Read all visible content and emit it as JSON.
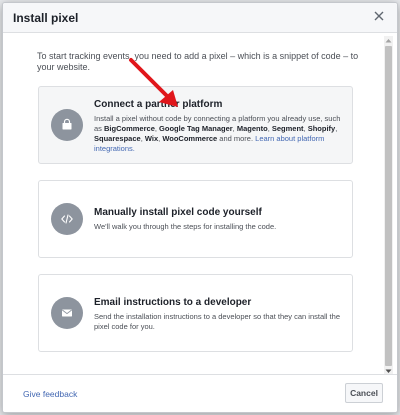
{
  "dialog": {
    "title": "Install pixel",
    "close_icon": "close-icon"
  },
  "intro": "To start tracking events, you need to add a pixel – which is a snippet of code – to your website.",
  "options": [
    {
      "icon": "shopping-bag-icon",
      "title": "Connect a partner platform",
      "desc_prefix": "Install a pixel without code by connecting a platform you already use, such as ",
      "partners": [
        "BigCommerce",
        "Google Tag Manager",
        "Magento",
        "Segment",
        "Shopify",
        "Squarespace",
        "Wix",
        "WooCommerce"
      ],
      "desc_suffix": " and more.",
      "link": "Learn about platform integrations."
    },
    {
      "icon": "code-icon",
      "title": "Manually install pixel code yourself",
      "desc": "We'll walk you through the steps for installing the code."
    },
    {
      "icon": "envelope-icon",
      "title": "Email instructions to a developer",
      "desc": "Send the installation instructions to a developer so that they can install the pixel code for you."
    }
  ],
  "footer": {
    "feedback": "Give feedback",
    "cancel": "Cancel"
  },
  "colors": {
    "link": "#4267b2",
    "annotation_arrow": "#e0161b",
    "icon_circle": "#8d949e"
  }
}
